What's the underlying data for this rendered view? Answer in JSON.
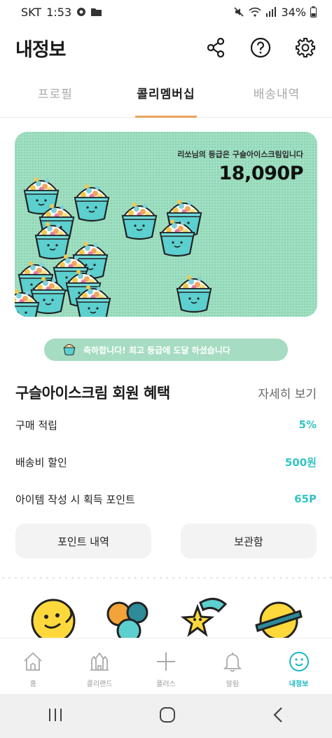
{
  "status_bar": {
    "carrier": "SKT",
    "time": "1:53",
    "battery": "34%"
  },
  "header": {
    "title": "내정보",
    "icons": [
      "share-icon",
      "help-icon",
      "settings-icon"
    ]
  },
  "tabs": [
    {
      "label": "프로필",
      "active": false
    },
    {
      "label": "콜리멤버십",
      "active": true
    },
    {
      "label": "배송내역",
      "active": false
    }
  ],
  "membership": {
    "grade_text": "리쏘님의 등급은 구슬아이스크림입니다",
    "points": "18,090P",
    "congrats": "축하합니다! 최고 등급에 도달 하셨습니다"
  },
  "benefits": {
    "title": "구슬아이스크림 회원 혜택",
    "detail_link": "자세히 보기",
    "items": [
      {
        "label": "구매 적립",
        "value": "5%"
      },
      {
        "label": "배송비 할인",
        "value": "500원"
      },
      {
        "label": "아이템 작성 시 획득 포인트",
        "value": "65P"
      }
    ]
  },
  "buttons": {
    "points_history": "포인트 내역",
    "storage": "보관함"
  },
  "bottom_nav": [
    {
      "label": "홈",
      "icon": "home-icon",
      "active": false
    },
    {
      "label": "콜리랜드",
      "icon": "castle-icon",
      "active": false
    },
    {
      "label": "플러스",
      "icon": "plus-icon",
      "active": false
    },
    {
      "label": "알림",
      "icon": "bell-icon",
      "active": false
    },
    {
      "label": "내정보",
      "icon": "smiley-icon",
      "active": true
    }
  ],
  "colors": {
    "accent": "#36c3c3",
    "tab_underline": "#e9a35a",
    "banner_bg": "#9fe0c2",
    "congrats_bg": "#a6dcc1"
  }
}
